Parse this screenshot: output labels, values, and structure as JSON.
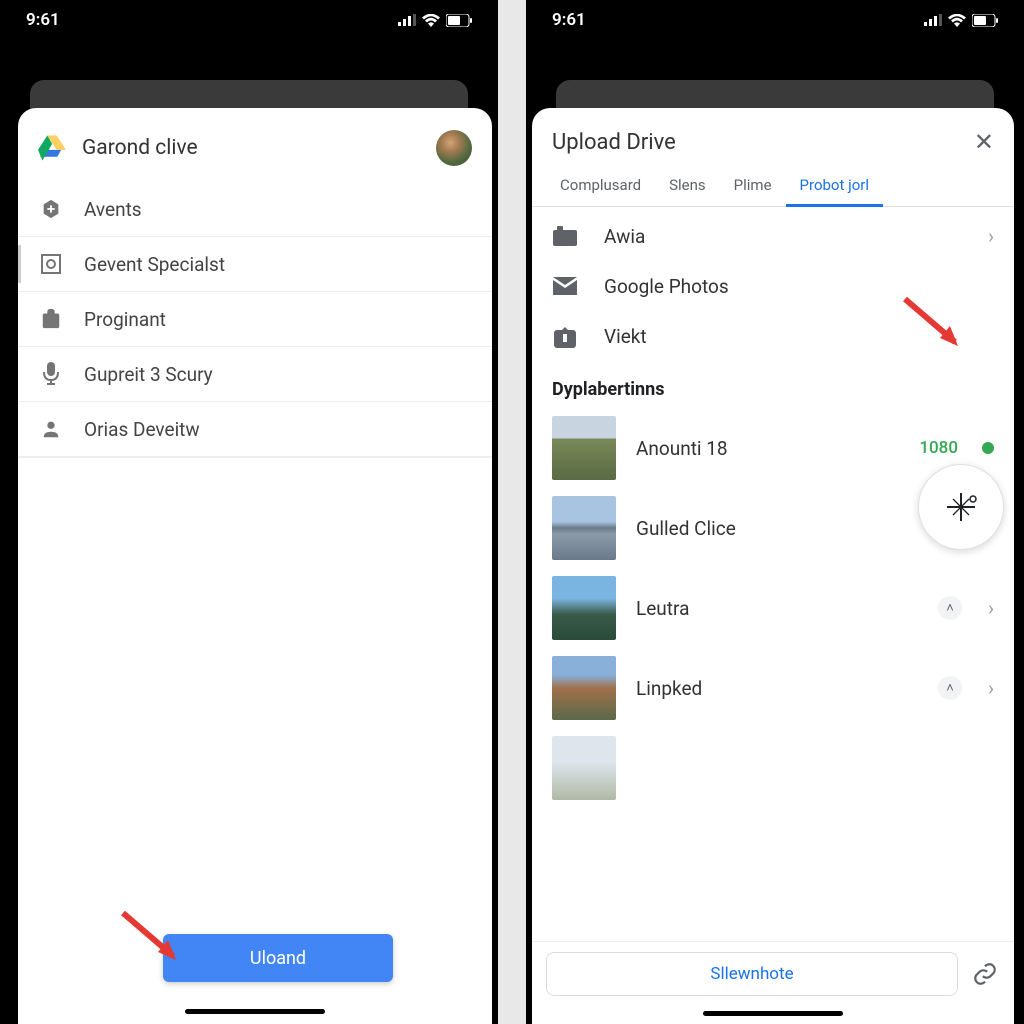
{
  "status": {
    "time": "9:61"
  },
  "left": {
    "header_title": "Garond clive",
    "items": [
      {
        "label": "Avents"
      },
      {
        "label": "Gevent Specialst"
      },
      {
        "label": "Proginant"
      },
      {
        "label": "Gupreit 3 Scury"
      },
      {
        "label": "Orias Deveitw"
      }
    ],
    "upload_label": "Uloand"
  },
  "right": {
    "title": "Upload Drive",
    "tabs": [
      {
        "label": "Complusard",
        "active": false
      },
      {
        "label": "Slens",
        "active": false
      },
      {
        "label": "Plime",
        "active": false
      },
      {
        "label": "Probot jorl",
        "active": true
      }
    ],
    "sources": [
      {
        "label": "Awia",
        "chevron": true
      },
      {
        "label": "Google Photos",
        "chevron": false
      },
      {
        "label": "Viekt",
        "chevron": false
      }
    ],
    "section_heading": "Dyplabertinns",
    "files": [
      {
        "label": "Anounti 18",
        "status": "1080",
        "dot": true
      },
      {
        "label": "Gulled Clice"
      },
      {
        "label": "Leutra"
      },
      {
        "label": "Linpked"
      }
    ],
    "select_label": "Sllewnhote"
  }
}
